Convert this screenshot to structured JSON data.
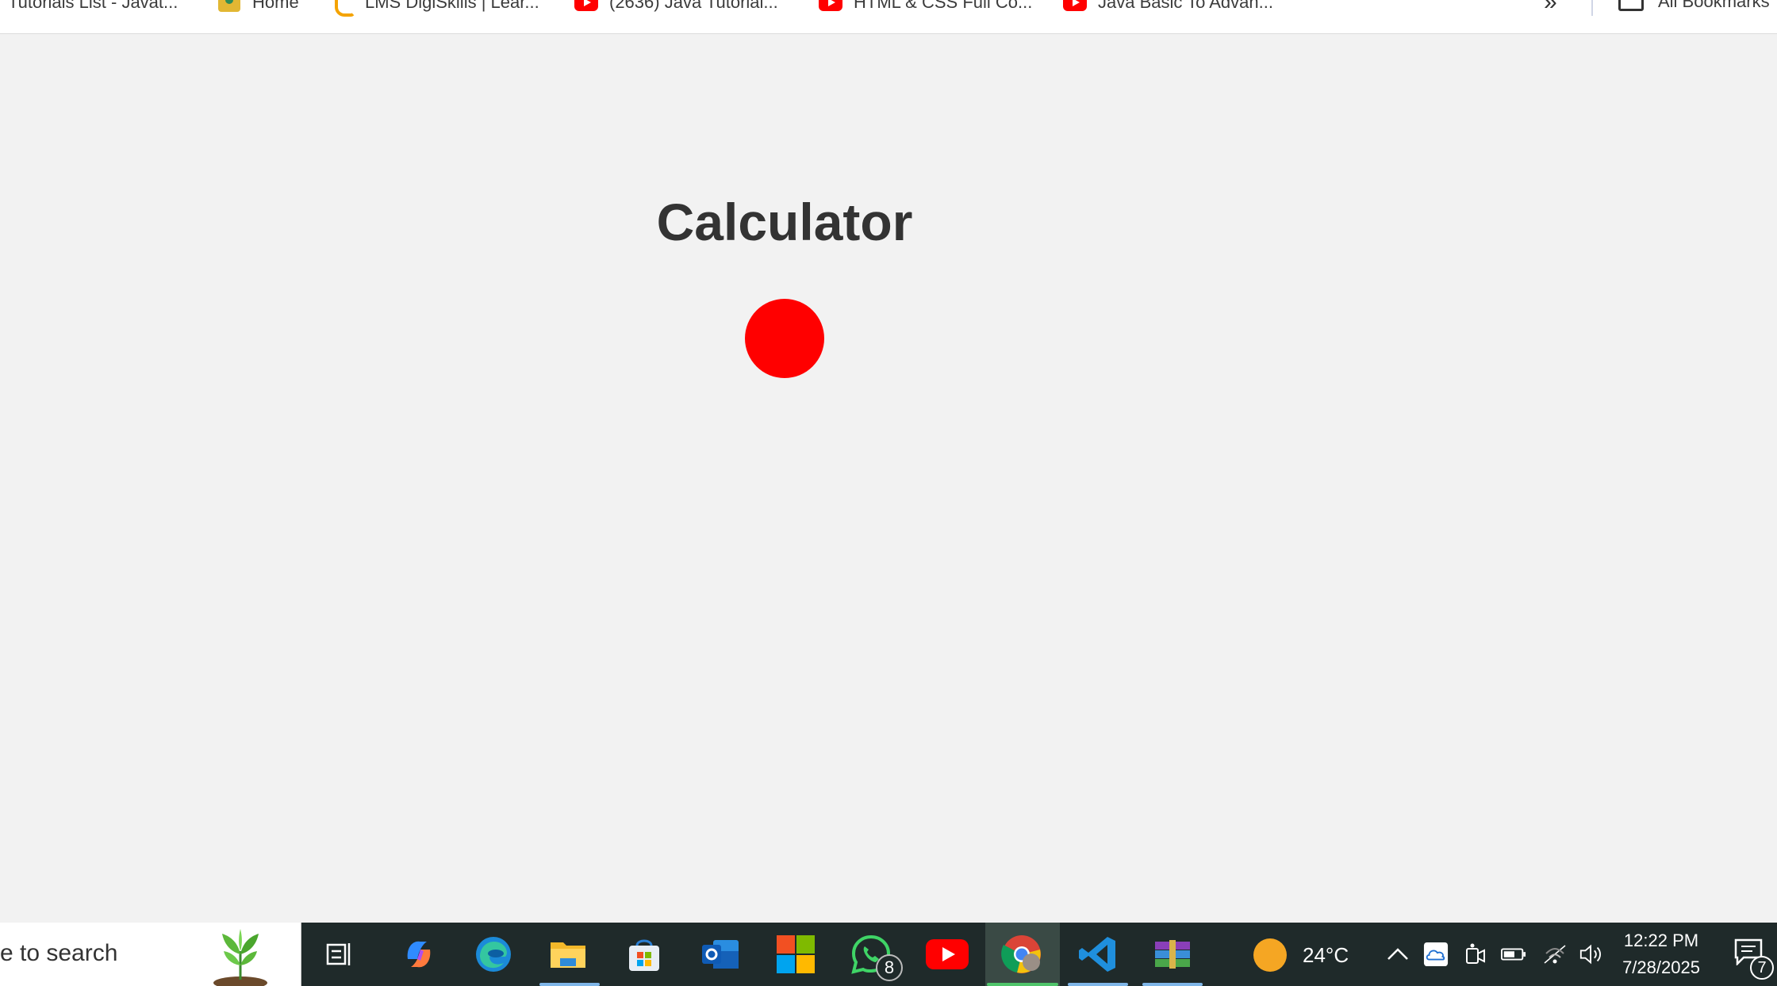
{
  "bookmarks": [
    {
      "label": "Tutorials List - Javat...",
      "icon": "javatpoint-icon"
    },
    {
      "label": "Home",
      "icon": "home-icon"
    },
    {
      "label": "LMS DigiSkills | Lear...",
      "icon": "digiskills-icon"
    },
    {
      "label": "(2636) Java Tutorial...",
      "icon": "youtube-icon"
    },
    {
      "label": "HTML & CSS Full Co...",
      "icon": "youtube-icon"
    },
    {
      "label": "Java Basic To Advan...",
      "icon": "youtube-icon"
    }
  ],
  "bookmarks_overflow": "»",
  "all_bookmarks_label": "All Bookmarks",
  "page": {
    "title": "Calculator",
    "dot_color": "#ff0000"
  },
  "taskbar": {
    "search_text": "e to search",
    "weather_temp": "24°C",
    "time": "12:22 PM",
    "date": "7/28/2025",
    "notification_count": "7",
    "whatsapp_badge": "8",
    "apps": [
      "task-view-icon",
      "copilot-icon",
      "edge-icon",
      "file-explorer-icon",
      "microsoft-store-icon",
      "outlook-icon",
      "microsoft-icon",
      "whatsapp-icon",
      "youtube-icon",
      "chrome-icon",
      "vscode-icon",
      "winrar-icon"
    ]
  }
}
